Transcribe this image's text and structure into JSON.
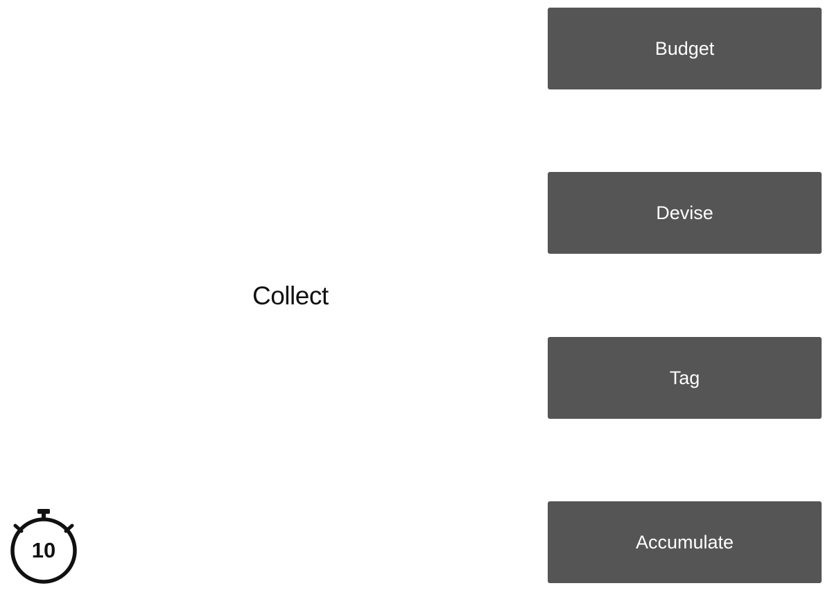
{
  "prompt": {
    "word": "Collect"
  },
  "options": [
    {
      "label": "Budget"
    },
    {
      "label": "Devise"
    },
    {
      "label": "Tag"
    },
    {
      "label": "Accumulate"
    }
  ],
  "timer": {
    "icon": "stopwatch-icon",
    "value": "10"
  },
  "colors": {
    "option_background": "#555555",
    "option_text": "#ffffff",
    "prompt_text": "#111111"
  }
}
